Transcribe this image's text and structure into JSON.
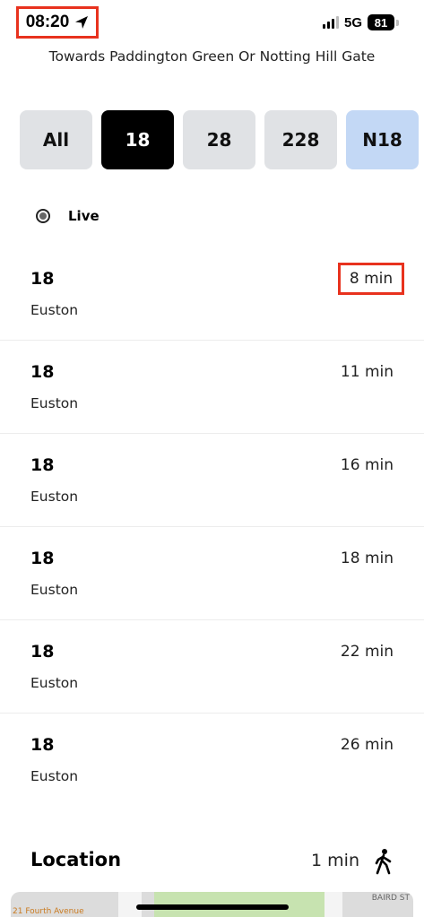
{
  "status_bar": {
    "time": "08:20",
    "network": "5G",
    "battery": "81"
  },
  "direction": "Towards Paddington Green Or Notting Hill Gate",
  "route_filters": [
    "All",
    "18",
    "28",
    "228",
    "N18"
  ],
  "selected_filter": "18",
  "live": {
    "label": "Live"
  },
  "departures": [
    {
      "route": "18",
      "destination": "Euston",
      "time": "8 min"
    },
    {
      "route": "18",
      "destination": "Euston",
      "time": "11 min"
    },
    {
      "route": "18",
      "destination": "Euston",
      "time": "16 min"
    },
    {
      "route": "18",
      "destination": "Euston",
      "time": "18 min"
    },
    {
      "route": "18",
      "destination": "Euston",
      "time": "22 min"
    },
    {
      "route": "18",
      "destination": "Euston",
      "time": "26 min"
    }
  ],
  "location": {
    "title": "Location",
    "walk_time": "1 min"
  },
  "map": {
    "label_left": "21 Fourth Avenue",
    "label_right": "BAIRD ST"
  },
  "colors": {
    "highlight": "#e8321e",
    "chip_bg": "#e0e2e5",
    "night_chip_bg": "#c3d8f5"
  }
}
